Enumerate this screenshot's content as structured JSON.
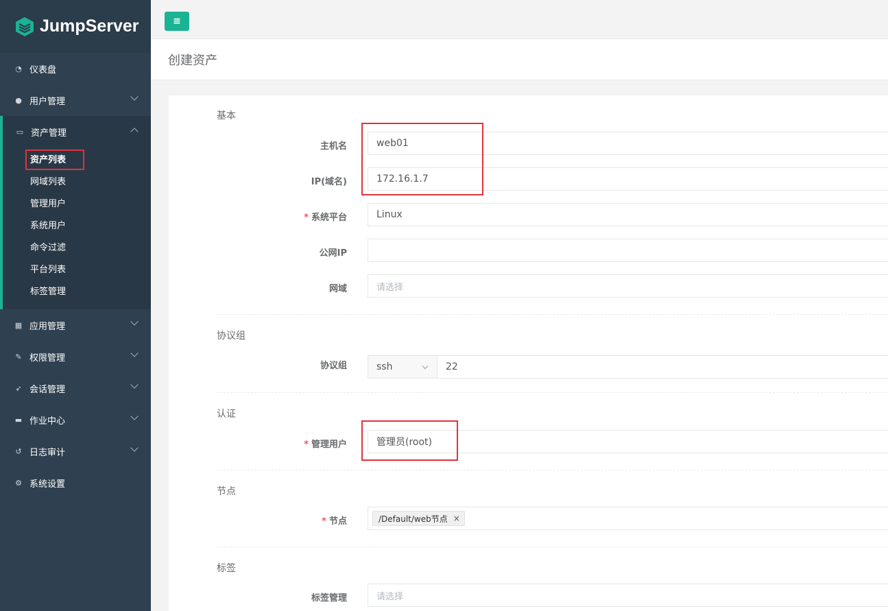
{
  "app": {
    "name": "JumpServer"
  },
  "colors": {
    "accent": "#1ab394",
    "sidebar": "#2f4050",
    "highlight": "#e0333a",
    "required": "#ed5565"
  },
  "sidebar": {
    "items": [
      {
        "label": "仪表盘",
        "icon": "dashboard-icon"
      },
      {
        "label": "用户管理",
        "icon": "users-icon"
      },
      {
        "label": "资产管理",
        "icon": "inbox-icon"
      },
      {
        "label": "应用管理",
        "icon": "grid-icon"
      },
      {
        "label": "权限管理",
        "icon": "edit-icon"
      },
      {
        "label": "会话管理",
        "icon": "rocket-icon"
      },
      {
        "label": "作业中心",
        "icon": "coffee-icon"
      },
      {
        "label": "日志审计",
        "icon": "history-icon"
      },
      {
        "label": "系统设置",
        "icon": "gears-icon"
      }
    ],
    "asset_sub": [
      "资产列表",
      "网域列表",
      "管理用户",
      "系统用户",
      "命令过滤",
      "平台列表",
      "标签管理"
    ]
  },
  "toolbar": {
    "toggle_label": "≡"
  },
  "page": {
    "title": "创建资产"
  },
  "form": {
    "sections": {
      "basic": "基本",
      "protocol": "协议组",
      "auth": "认证",
      "node": "节点",
      "labels": "标签"
    },
    "fields": {
      "hostname": {
        "label": "主机名",
        "value": "web01"
      },
      "ip": {
        "label": "IP(域名)",
        "value": "172.16.1.7"
      },
      "platform": {
        "label": "系统平台",
        "value": "Linux"
      },
      "public_ip": {
        "label": "公网IP",
        "value": ""
      },
      "domain": {
        "label": "网域",
        "placeholder": "请选择"
      },
      "protocols": {
        "label": "协议组",
        "protocol": "ssh",
        "port": "22"
      },
      "admin_user": {
        "label": "管理用户",
        "value": "管理员(root)"
      },
      "nodes": {
        "label": "节点",
        "tag": "/Default/web节点"
      },
      "labels": {
        "label": "标签管理",
        "placeholder": "请选择"
      }
    },
    "required_mark": "*",
    "tag_remove": "×"
  }
}
